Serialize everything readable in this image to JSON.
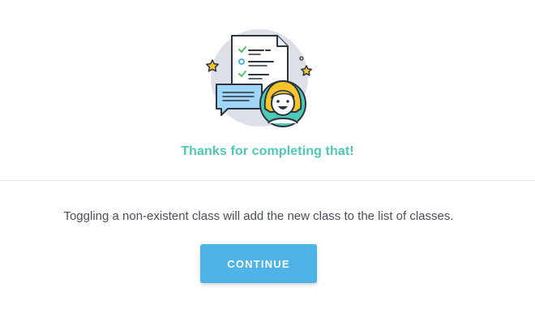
{
  "success": {
    "heading": "Thanks for completing that!",
    "message": "Toggling a non-existent class will add the new class to the list of classes.",
    "continue_label": "CONTINUE"
  },
  "colors": {
    "heading": "#4fc9b7",
    "button": "#4fb3e8",
    "text": "#4a5058",
    "divider": "#e4e7ea"
  },
  "illustration": {
    "icons": [
      "document-checklist-icon",
      "speech-bubble-icon",
      "avatar-icon",
      "star-icon"
    ]
  }
}
